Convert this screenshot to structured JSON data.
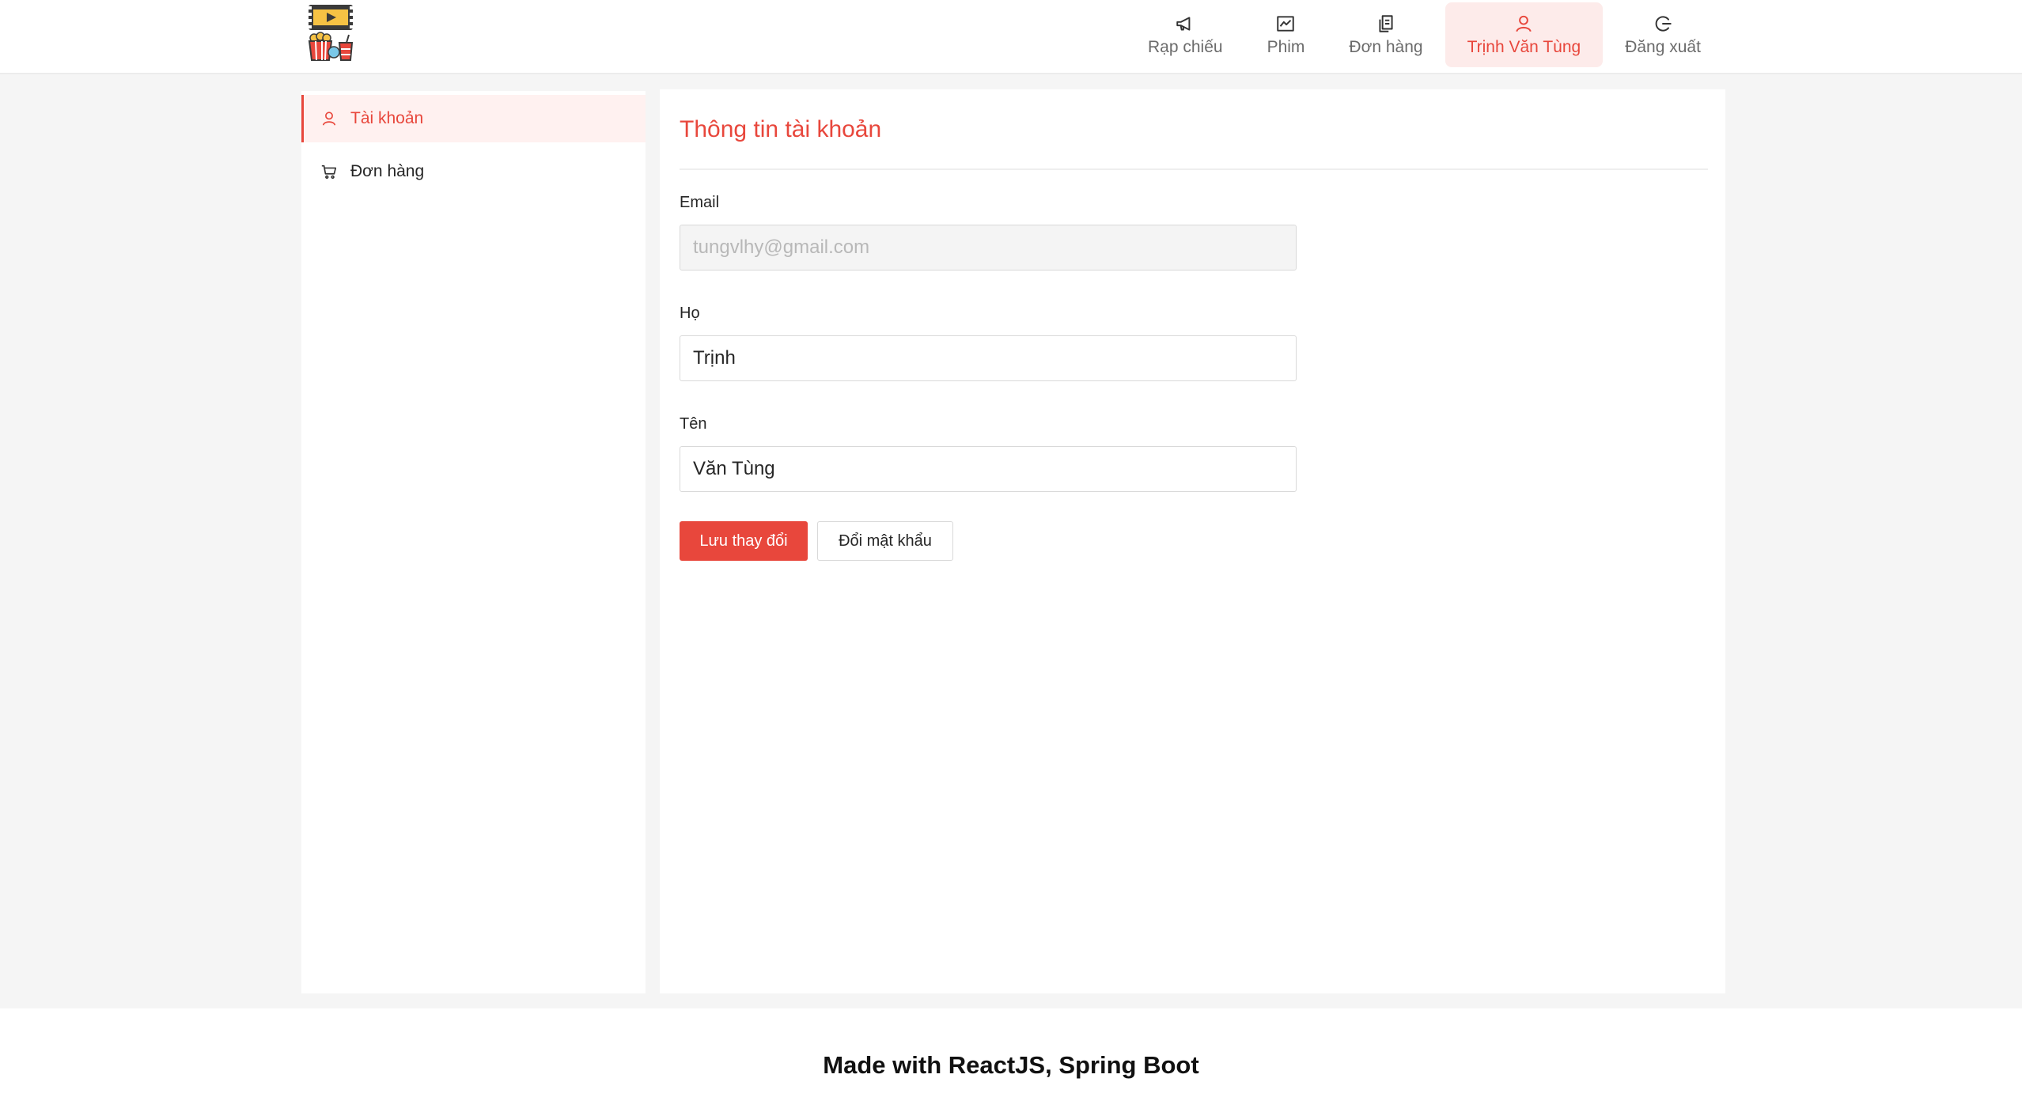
{
  "header": {
    "logo_icon": "cinema-popcorn-logo",
    "nav": [
      {
        "label": "Rạp chiếu",
        "icon": "megaphone-icon"
      },
      {
        "label": "Phim",
        "icon": "chart-icon"
      },
      {
        "label": "Đơn hàng",
        "icon": "document-copy-icon"
      },
      {
        "label": "Trịnh Văn Tùng",
        "icon": "user-icon",
        "active": true
      },
      {
        "label": "Đăng xuất",
        "icon": "logout-icon"
      }
    ]
  },
  "sidebar": {
    "items": [
      {
        "label": "Tài khoản",
        "icon": "user-icon",
        "active": true
      },
      {
        "label": "Đơn hàng",
        "icon": "cart-icon"
      }
    ]
  },
  "main": {
    "title": "Thông tin tài khoản",
    "fields": [
      {
        "label": "Email",
        "value": "tungvlhy@gmail.com",
        "disabled": true
      },
      {
        "label": "Họ",
        "value": "Trịnh"
      },
      {
        "label": "Tên",
        "value": "Văn Tùng"
      }
    ],
    "save_button": "Lưu thay đổi",
    "change_password_button": "Đổi mật khẩu"
  },
  "footer": {
    "text": "Made with ReactJS, Spring Boot"
  },
  "colors": {
    "accent": "#e8473c",
    "accent_light": "#fdebea",
    "background": "#f5f5f5"
  }
}
